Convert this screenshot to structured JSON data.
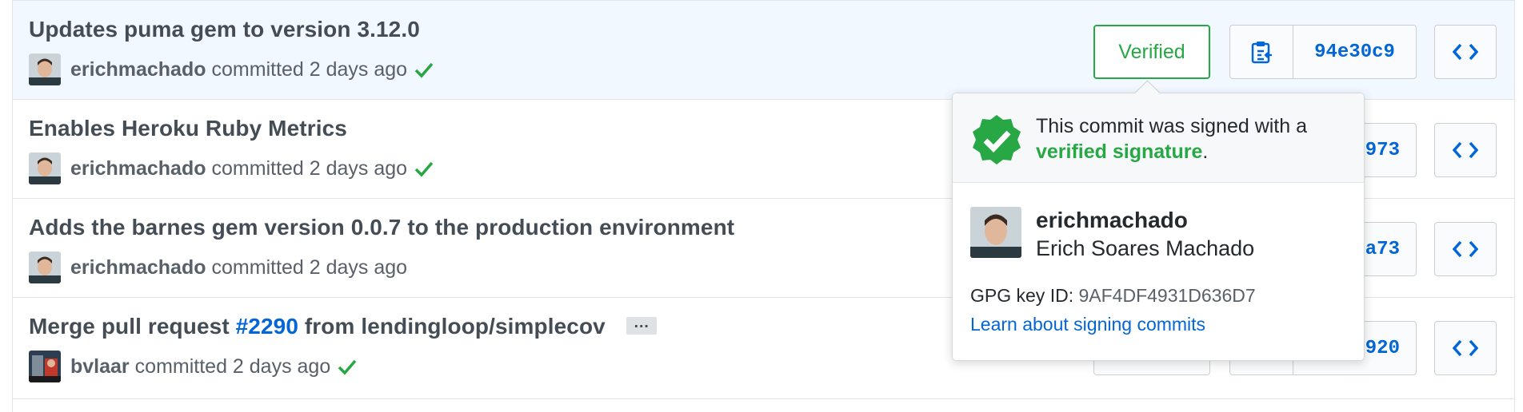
{
  "commits": [
    {
      "title": "Updates puma gem to version 3.12.0",
      "author": "erichmachado",
      "committed_text": "committed 2 days ago",
      "verified": true,
      "verified_label": "Verified",
      "sha": "94e30c9"
    },
    {
      "title": "Enables Heroku Ruby Metrics",
      "author": "erichmachado",
      "committed_text": "committed 2 days ago",
      "sha_visible": "973"
    },
    {
      "title": "Adds the barnes gem version 0.0.7 to the production environment",
      "author": "erichmachado",
      "committed_text": "committed 2 days ago",
      "sha_visible": "a73"
    },
    {
      "title_prefix": "Merge pull request ",
      "pr_link": "#2290",
      "title_suffix": " from lendingloop/simplecov",
      "ellipsis": "…",
      "author": "bvlaar",
      "committed_text": "committed 2 days ago",
      "sha_visible": "920"
    }
  ],
  "popover": {
    "message_prefix": "This commit was signed with a",
    "signature_label": "verified signature",
    "message_suffix": ".",
    "login": "erichmachado",
    "full_name": "Erich Soares Machado",
    "gpg_label": "GPG key ID:",
    "gpg_key": "9AF4DF4931D636D7",
    "learn_link": "Learn about signing commits"
  },
  "icons": {
    "check": "check-icon",
    "clipboard": "clipboard-icon",
    "code": "code-icon",
    "verified_badge": "verified-badge-icon"
  },
  "colors": {
    "success": "#28a745",
    "link": "#0366d6",
    "row_highlight": "#f1f8ff"
  }
}
